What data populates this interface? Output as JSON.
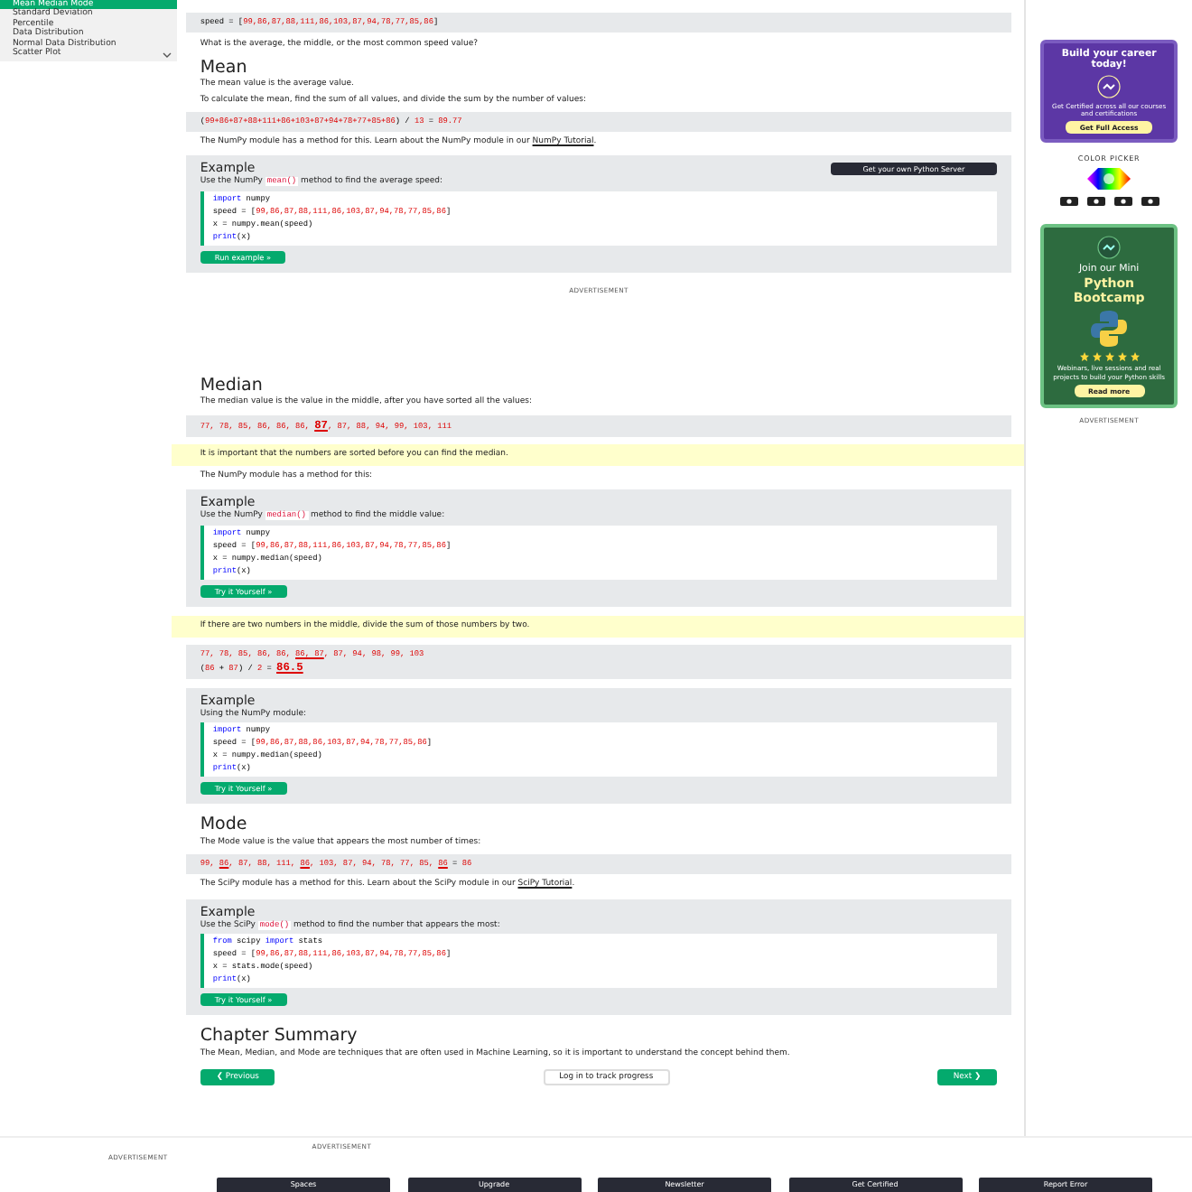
{
  "sidebar": {
    "items": [
      {
        "label": "Mean Median Mode",
        "selected": true
      },
      {
        "label": "Standard Deviation",
        "selected": false
      },
      {
        "label": "Percentile",
        "selected": false
      },
      {
        "label": "Data Distribution",
        "selected": false
      },
      {
        "label": "Normal Data Distribution",
        "selected": false
      },
      {
        "label": "Scatter Plot",
        "selected": false
      }
    ]
  },
  "main": [
    {
      "kind": "codebox",
      "lines": [
        [
          {
            "kind": "text",
            "text": "speed = ["
          },
          {
            "kind": "number",
            "text": "99,86,87,88,111,86,103,87,94,78,77,85,86"
          },
          {
            "kind": "text",
            "text": "]"
          }
        ]
      ]
    },
    {
      "kind": "paragraph",
      "segments": [
        {
          "kind": "text",
          "text": "What is the average, the middle, or the most common speed value?"
        }
      ]
    },
    {
      "kind": "heading",
      "text": "Mean"
    },
    {
      "kind": "paragraph",
      "segments": [
        {
          "kind": "text",
          "text": "The mean value is the average value."
        }
      ]
    },
    {
      "kind": "paragraph",
      "segments": [
        {
          "kind": "text",
          "text": "To calculate the mean, find the sum of all values, and divide the sum by the number of values:"
        }
      ]
    },
    {
      "kind": "codebox",
      "lines": [
        [
          {
            "kind": "text",
            "text": "("
          },
          {
            "kind": "number",
            "text": "99+86+87+88+111+86+103+87+94+78+77+85+86"
          },
          {
            "kind": "text",
            "text": ") / "
          },
          {
            "kind": "number",
            "text": "13"
          },
          {
            "kind": "text",
            "text": " = "
          },
          {
            "kind": "number",
            "text": "89.77"
          }
        ]
      ]
    },
    {
      "kind": "paragraph",
      "segments": [
        {
          "kind": "text",
          "text": "The NumPy module has a method for this. Learn about the NumPy module in our "
        },
        {
          "kind": "link",
          "text": "NumPy Tutorial"
        },
        {
          "kind": "text",
          "text": "."
        }
      ]
    },
    {
      "kind": "example",
      "title": "Example",
      "server": "Get your own Python Server",
      "intro": [
        {
          "kind": "text",
          "text": "Use the NumPy "
        },
        {
          "kind": "code",
          "text": "mean()"
        },
        {
          "kind": "text",
          "text": " method to find the average speed:"
        }
      ],
      "code": [
        [
          {
            "kind": "keyword",
            "text": "import"
          },
          {
            "kind": "text",
            "text": " numpy"
          }
        ],
        [
          {
            "kind": "text",
            "text": "speed = ["
          },
          {
            "kind": "number",
            "text": "99,86,87,88,111,86,103,87,94,78,77,85,86"
          },
          {
            "kind": "text",
            "text": "]"
          }
        ],
        [
          {
            "kind": "text",
            "text": "x = numpy.mean(speed)"
          }
        ],
        [
          {
            "kind": "keyword",
            "text": "print"
          },
          {
            "kind": "text",
            "text": "(x)"
          }
        ]
      ],
      "button": "Run example »"
    },
    {
      "kind": "ad",
      "text": "ADVERTISEMENT"
    },
    {
      "kind": "heading",
      "text": "Median"
    },
    {
      "kind": "paragraph",
      "segments": [
        {
          "kind": "text",
          "text": "The median value is the value in the middle, after you have sorted all the values:"
        }
      ]
    },
    {
      "kind": "codebox",
      "lines": [
        [
          {
            "kind": "number",
            "text": "77, 78, 85, 86, 86, 86, "
          },
          {
            "kind": "mark",
            "text": "87"
          },
          {
            "kind": "number",
            "text": ", 87, 88, 94, 99, 103, 111"
          }
        ]
      ]
    },
    {
      "kind": "note",
      "text": "It is important that the numbers are sorted before you can find the median."
    },
    {
      "kind": "paragraph",
      "segments": [
        {
          "kind": "text",
          "text": "The NumPy module has a method for this:"
        }
      ]
    },
    {
      "kind": "example",
      "title": "Example",
      "intro": [
        {
          "kind": "text",
          "text": "Use the NumPy "
        },
        {
          "kind": "code",
          "text": "median()"
        },
        {
          "kind": "text",
          "text": " method to find the middle value:"
        }
      ],
      "code": [
        [
          {
            "kind": "keyword",
            "text": "import"
          },
          {
            "kind": "text",
            "text": " numpy"
          }
        ],
        [
          {
            "kind": "text",
            "text": "speed = ["
          },
          {
            "kind": "number",
            "text": "99,86,87,88,111,86,103,87,94,78,77,85,86"
          },
          {
            "kind": "text",
            "text": "]"
          }
        ],
        [
          {
            "kind": "text",
            "text": "x = numpy.median(speed)"
          }
        ],
        [
          {
            "kind": "keyword",
            "text": "print"
          },
          {
            "kind": "text",
            "text": "(x)"
          }
        ]
      ],
      "button": "Try it Yourself »"
    },
    {
      "kind": "note",
      "text": "If there are two numbers in the middle, divide the sum of those numbers by two."
    },
    {
      "kind": "codebox",
      "lines": [
        [
          {
            "kind": "number",
            "text": "77, 78, 85, 86, 86, "
          },
          {
            "kind": "underline",
            "text": "86, 87"
          },
          {
            "kind": "number",
            "text": ", 87, 94, 98, 99, 103"
          }
        ],
        [
          {
            "kind": "text",
            "text": "("
          },
          {
            "kind": "number",
            "text": "86"
          },
          {
            "kind": "text",
            "text": " + "
          },
          {
            "kind": "number",
            "text": "87"
          },
          {
            "kind": "text",
            "text": ") / "
          },
          {
            "kind": "number",
            "text": "2"
          },
          {
            "kind": "text",
            "text": " = "
          },
          {
            "kind": "mark",
            "text": "86.5"
          }
        ]
      ]
    },
    {
      "kind": "example",
      "title": "Example",
      "intro": [
        {
          "kind": "text",
          "text": "Using the NumPy module:"
        }
      ],
      "code": [
        [
          {
            "kind": "keyword",
            "text": "import"
          },
          {
            "kind": "text",
            "text": " numpy"
          }
        ],
        [
          {
            "kind": "text",
            "text": "speed = ["
          },
          {
            "kind": "number",
            "text": "99,86,87,88,86,103,87,94,78,77,85,86"
          },
          {
            "kind": "text",
            "text": "]"
          }
        ],
        [
          {
            "kind": "text",
            "text": "x = numpy.median(speed)"
          }
        ],
        [
          {
            "kind": "keyword",
            "text": "print"
          },
          {
            "kind": "text",
            "text": "(x)"
          }
        ]
      ],
      "button": "Try it Yourself »"
    },
    {
      "kind": "heading",
      "text": "Mode"
    },
    {
      "kind": "paragraph",
      "segments": [
        {
          "kind": "text",
          "text": "The Mode value is the value that appears the most number of times:"
        }
      ]
    },
    {
      "kind": "codebox",
      "lines": [
        [
          {
            "kind": "number",
            "text": "99, "
          },
          {
            "kind": "underline",
            "text": "86"
          },
          {
            "kind": "number",
            "text": ", 87, 88, 111, "
          },
          {
            "kind": "underline",
            "text": "86"
          },
          {
            "kind": "number",
            "text": ", 103, 87, 94, 78, 77, 85, "
          },
          {
            "kind": "underline",
            "text": "86"
          },
          {
            "kind": "text",
            "text": " = "
          },
          {
            "kind": "number",
            "text": "86"
          }
        ]
      ]
    },
    {
      "kind": "paragraph",
      "segments": [
        {
          "kind": "text",
          "text": "The SciPy module has a method for this. Learn about the SciPy module in our "
        },
        {
          "kind": "link",
          "text": "SciPy Tutorial"
        },
        {
          "kind": "text",
          "text": "."
        }
      ]
    },
    {
      "kind": "example",
      "title": "Example",
      "intro": [
        {
          "kind": "text",
          "text": "Use the SciPy "
        },
        {
          "kind": "code",
          "text": "mode()"
        },
        {
          "kind": "text",
          "text": " method to find the number that appears the most:"
        }
      ],
      "code": [
        [
          {
            "kind": "keyword",
            "text": "from"
          },
          {
            "kind": "text",
            "text": " scipy "
          },
          {
            "kind": "keyword",
            "text": "import"
          },
          {
            "kind": "text",
            "text": " stats"
          }
        ],
        [
          {
            "kind": "text",
            "text": "speed = ["
          },
          {
            "kind": "number",
            "text": "99,86,87,88,111,86,103,87,94,78,77,85,86"
          },
          {
            "kind": "text",
            "text": "]"
          }
        ],
        [
          {
            "kind": "text",
            "text": "x = stats.mode(speed)"
          }
        ],
        [
          {
            "kind": "keyword",
            "text": "print"
          },
          {
            "kind": "text",
            "text": "(x)"
          }
        ]
      ],
      "button": "Try it Yourself »"
    },
    {
      "kind": "heading",
      "text": "Chapter Summary"
    },
    {
      "kind": "paragraph",
      "segments": [
        {
          "kind": "text",
          "text": "The Mean, Median, and Mode are techniques that are often used in Machine Learning, so it is important to understand the concept behind them."
        }
      ]
    },
    {
      "kind": "nav",
      "previous": "❮ Previous",
      "progress": "Log in to track progress",
      "next": "Next ❯"
    }
  ],
  "bottom_ads": [
    "ADVERTISEMENT",
    "ADVERTISEMENT"
  ],
  "footer": [
    "Spaces",
    "Upgrade",
    "Newsletter",
    "Get Certified",
    "Report Error"
  ],
  "right": {
    "promo": {
      "title": "Build your career today!",
      "text": "Get Certified across all our courses and certifications",
      "button": "Get Full Access"
    },
    "color_picker": "COLOR PICKER",
    "bootcamp": {
      "title": "Join our Mini",
      "highlight": "Python Bootcamp",
      "stars": 5,
      "text": "Webinars, live sessions and real projects to build your Python skills",
      "button": "Read more"
    },
    "ad": "ADVERTISEMENT"
  }
}
